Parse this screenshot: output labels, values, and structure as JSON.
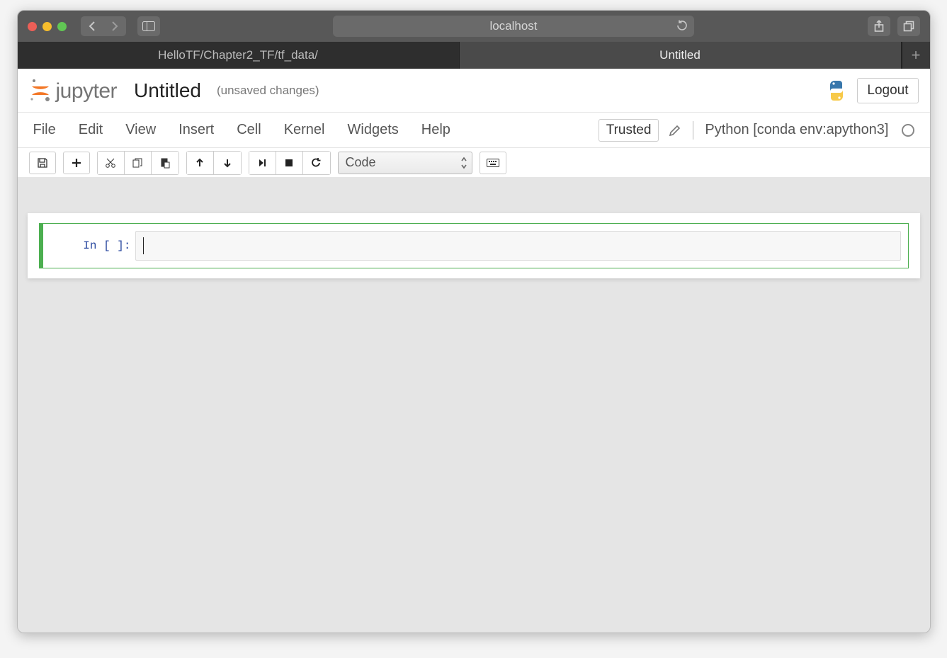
{
  "browser": {
    "url": "localhost",
    "tabs": [
      {
        "title": "HelloTF/Chapter2_TF/tf_data/",
        "active": false
      },
      {
        "title": "Untitled",
        "active": true
      }
    ]
  },
  "header": {
    "logo_text": "jupyter",
    "notebook_title": "Untitled",
    "save_status": "(unsaved changes)",
    "logout": "Logout"
  },
  "menus": {
    "file": "File",
    "edit": "Edit",
    "view": "View",
    "insert": "Insert",
    "cell": "Cell",
    "kernel": "Kernel",
    "widgets": "Widgets",
    "help": "Help",
    "trusted": "Trusted",
    "kernel_name": "Python [conda env:apython3]"
  },
  "toolbar": {
    "cell_type": "Code"
  },
  "cell": {
    "prompt": "In [ ]:"
  }
}
